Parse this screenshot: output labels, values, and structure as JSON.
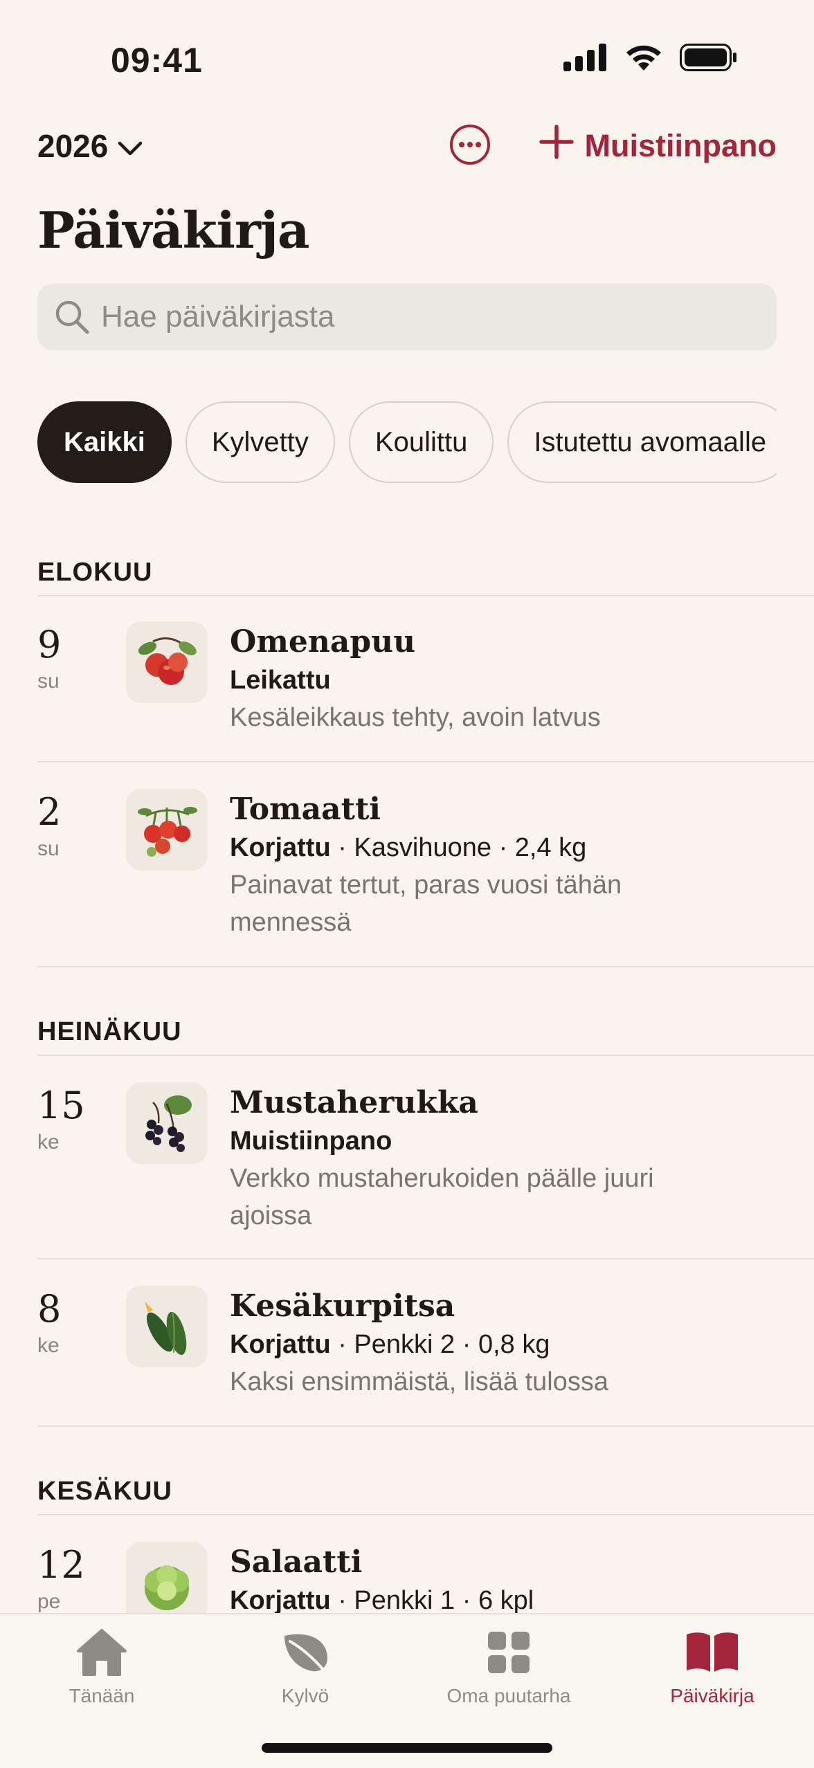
{
  "status": {
    "time": "09:41"
  },
  "header": {
    "year": "2026",
    "add_note_label": "Muistiinpano"
  },
  "title": "Päiväkirja",
  "search": {
    "placeholder": "Hae päiväkirjasta"
  },
  "filters": [
    {
      "label": "Kaikki",
      "active": true
    },
    {
      "label": "Kylvetty",
      "active": false
    },
    {
      "label": "Koulittu",
      "active": false
    },
    {
      "label": "Istutettu avomaalle",
      "active": false
    }
  ],
  "sections": [
    {
      "month": "ELOKUU",
      "entries": [
        {
          "day": "9",
          "weekday": "su",
          "plant": "Omenapuu",
          "action": "Leikattu",
          "details": "",
          "note": "Kesäleikkaus tehty, avoin latvus",
          "icon": "apple-icon"
        },
        {
          "day": "2",
          "weekday": "su",
          "plant": "Tomaatti",
          "action": "Korjattu",
          "details": " · Kasvihuone · 2,4 kg",
          "note": "Painavat tertut, paras vuosi tähän mennessä",
          "icon": "tomato-icon"
        }
      ]
    },
    {
      "month": "HEINÄKUU",
      "entries": [
        {
          "day": "15",
          "weekday": "ke",
          "plant": "Mustaherukka",
          "action": "Muistiinpano",
          "details": "",
          "note": "Verkko mustaherukoiden päälle juuri ajoissa",
          "icon": "blackcurrant-icon"
        },
        {
          "day": "8",
          "weekday": "ke",
          "plant": "Kesäkurpitsa",
          "action": "Korjattu",
          "details": " · Penkki 2 · 0,8 kg",
          "note": "Kaksi ensimmäistä, lisää tulossa",
          "icon": "zucchini-icon"
        }
      ]
    },
    {
      "month": "KESÄKUU",
      "entries": [
        {
          "day": "12",
          "weekday": "pe",
          "plant": "Salaatti",
          "action": "Korjattu",
          "details": " · Penkki 1 · 6 kpl",
          "note": "",
          "icon": "lettuce-icon"
        }
      ]
    }
  ],
  "tabs": [
    {
      "label": "Tänään",
      "icon": "home-icon",
      "active": false
    },
    {
      "label": "Kylvö",
      "icon": "leaf-icon",
      "active": false
    },
    {
      "label": "Oma puutarha",
      "icon": "grid-icon",
      "active": false
    },
    {
      "label": "Päiväkirja",
      "icon": "book-icon",
      "active": true
    }
  ],
  "colors": {
    "accent": "#a3243b",
    "background": "#f9f4ee",
    "chip_active": "#231d19"
  }
}
